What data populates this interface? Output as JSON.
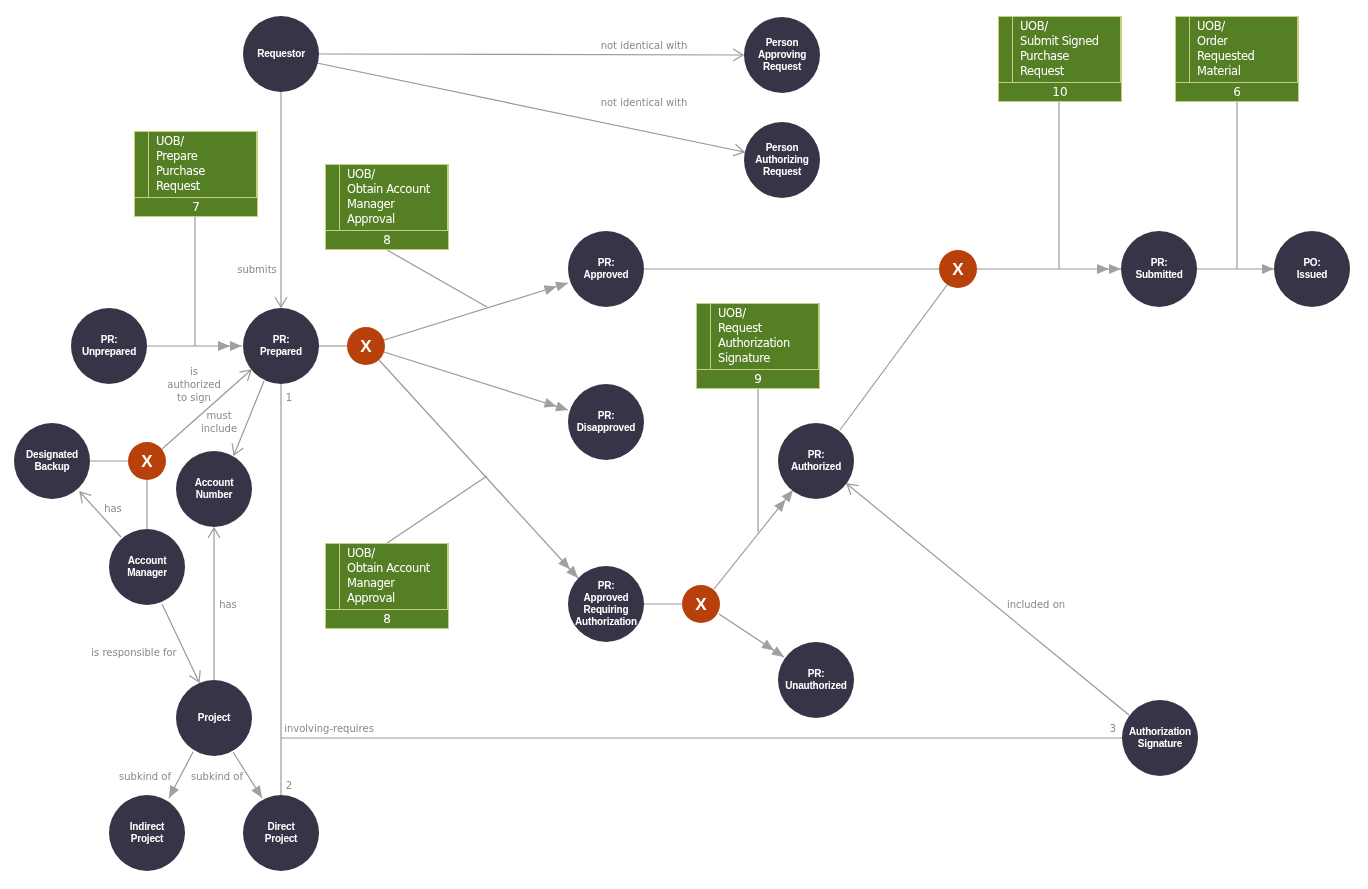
{
  "diagram": {
    "nodes": [
      {
        "kind": "object",
        "label": "Requestor"
      },
      {
        "kind": "object",
        "label": "Person\nApproving\nRequest"
      },
      {
        "kind": "object",
        "label": "Person\nAuthorizing\nRequest"
      },
      {
        "kind": "object",
        "label": "PR:\nUnprepared"
      },
      {
        "kind": "object",
        "label": "PR:\nPrepared"
      },
      {
        "kind": "object",
        "label": "PR:\nApproved"
      },
      {
        "kind": "object",
        "label": "PR:\nDisapproved"
      },
      {
        "kind": "object",
        "label": "Designated\nBackup"
      },
      {
        "kind": "object",
        "label": "Account\nNumber"
      },
      {
        "kind": "object",
        "label": "Account\nManager"
      },
      {
        "kind": "object",
        "label": "PR:\nApproved\nRequiring\nAuthorization"
      },
      {
        "kind": "object",
        "label": "PR:\nAuthorized"
      },
      {
        "kind": "object",
        "label": "PR:\nUnauthorized"
      },
      {
        "kind": "object",
        "label": "Project"
      },
      {
        "kind": "object",
        "label": "Authorization\nSignature"
      },
      {
        "kind": "object",
        "label": "Indirect\nProject"
      },
      {
        "kind": "object",
        "label": "Direct\nProject"
      },
      {
        "kind": "object",
        "label": "PR:\nSubmitted"
      },
      {
        "kind": "object",
        "label": "PO:\nIssued"
      },
      {
        "kind": "junction",
        "label": "X"
      },
      {
        "kind": "junction",
        "label": "X"
      },
      {
        "kind": "junction",
        "label": "X"
      },
      {
        "kind": "junction",
        "label": "X"
      },
      {
        "kind": "uob",
        "label": "UOB/\nPrepare\nPurchase\nRequest",
        "number": "7"
      },
      {
        "kind": "uob",
        "label": "UOB/\nObtain Account\nManager\nApproval",
        "number": "8"
      },
      {
        "kind": "uob",
        "label": "UOB/\nObtain Account\nManager\nApproval",
        "number": "8"
      },
      {
        "kind": "uob",
        "label": "UOB/\nRequest\nAuthorization\nSignature",
        "number": "9"
      },
      {
        "kind": "uob",
        "label": "UOB/\nSubmit Signed\nPurchase\nRequest",
        "number": "10"
      },
      {
        "kind": "uob",
        "label": "UOB/\nOrder\nRequested\nMaterial",
        "number": "6"
      }
    ],
    "connectors": [
      {
        "kind": "open",
        "label": "submits"
      },
      {
        "kind": "open",
        "label": "not identical with"
      },
      {
        "kind": "open",
        "label": "not identical with"
      },
      {
        "kind": "double"
      },
      {
        "kind": "none"
      },
      {
        "kind": "none"
      },
      {
        "kind": "double"
      },
      {
        "kind": "double"
      },
      {
        "kind": "double"
      },
      {
        "kind": "none"
      },
      {
        "kind": "none"
      },
      {
        "kind": "none"
      },
      {
        "kind": "double"
      },
      {
        "kind": "none"
      },
      {
        "kind": "single"
      },
      {
        "kind": "none"
      },
      {
        "kind": "none"
      },
      {
        "kind": "double"
      },
      {
        "kind": "none"
      },
      {
        "kind": "double"
      },
      {
        "kind": "none"
      },
      {
        "kind": "open",
        "label": "included on"
      },
      {
        "kind": "open",
        "label": "is\nauthorized\nto sign"
      },
      {
        "kind": "open",
        "label": "must\ninclude"
      },
      {
        "kind": "none"
      },
      {
        "kind": "none"
      },
      {
        "kind": "open",
        "label": "has"
      },
      {
        "kind": "open",
        "label": "is responsible for"
      },
      {
        "kind": "open",
        "label": "has"
      },
      {
        "kind": "single",
        "label": "subkind of"
      },
      {
        "kind": "single",
        "label": "subkind of"
      },
      {
        "kind": "none",
        "end_labels": [
          "1",
          "2"
        ]
      },
      {
        "kind": "none",
        "label": "involving-requires",
        "end_labels": [
          "3"
        ]
      }
    ]
  }
}
